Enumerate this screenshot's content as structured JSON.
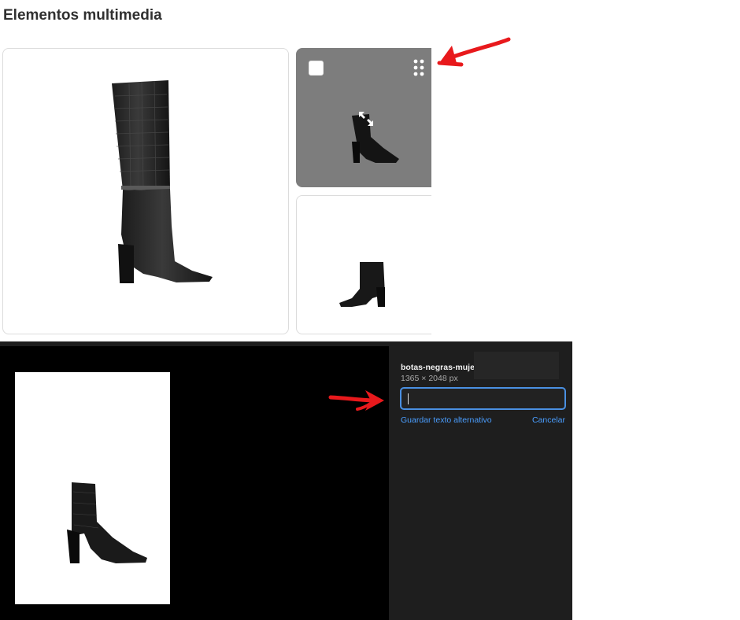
{
  "section": {
    "title": "Elementos multimedia"
  },
  "media": [
    {
      "name": "botas-altas"
    },
    {
      "name": "botin-negro",
      "selected": false
    },
    {
      "name": "botin-negro-2"
    }
  ],
  "icons": {
    "checkbox": "checkbox-icon",
    "drag": "drag-handle-icon",
    "expand": "expand-icon",
    "arrow": "red-arrow-icon"
  },
  "colors": {
    "accent": "#4a90e2",
    "link": "#4a9eff",
    "arrow": "#e8191c",
    "panel": "#1e1e1e"
  },
  "details": {
    "file_name": "botas-negras-mujer",
    "dimensions": "1365 × 2048 px",
    "alt_text_value": "",
    "save_alt_label": "Guardar texto alternativo",
    "cancel_label": "Cancelar"
  }
}
